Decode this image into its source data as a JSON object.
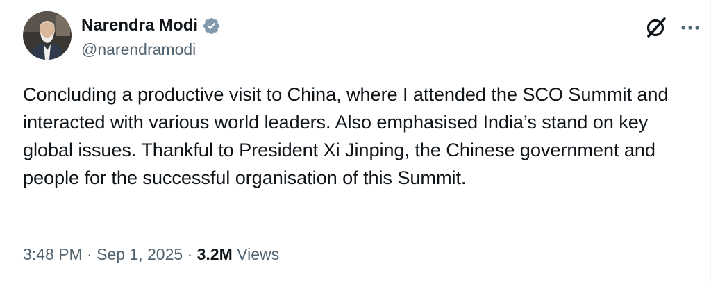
{
  "author": {
    "display_name": "Narendra Modi",
    "handle": "@narendramodi",
    "verified": true,
    "avatar_icon": "profile-photo"
  },
  "header_actions": {
    "grok_icon": "grok-icon",
    "more_icon": "more-horizontal-icon"
  },
  "tweet": {
    "text": "Concluding a productive visit to China, where I attended the SCO Summit and interacted with various world leaders. Also emphasised India’s stand on key global issues. Thankful to President Xi Jinping, the Chinese government and people for the successful organisation of this Summit."
  },
  "meta": {
    "time": "3:48 PM",
    "separator": "·",
    "date": "Sep 1, 2025",
    "views_count": "3.2M",
    "views_label": "Views"
  },
  "colors": {
    "text_primary": "#0f1419",
    "text_secondary": "#536471",
    "verified_badge": "#829aab",
    "background": "#ffffff"
  }
}
